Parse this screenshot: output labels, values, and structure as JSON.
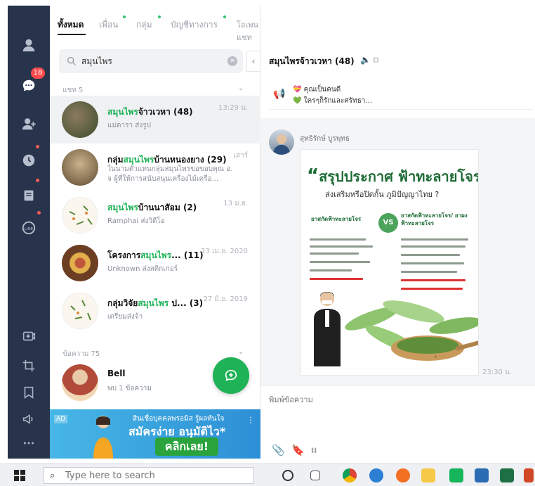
{
  "rail": {
    "badge": "18"
  },
  "tabs": [
    {
      "label": "ทั้งหมด"
    },
    {
      "label": "เพื่อน"
    },
    {
      "label": "กลุ่ม"
    },
    {
      "label": "บัญชีทางการ"
    },
    {
      "label": "โอเพนแชท"
    }
  ],
  "search": {
    "value": "สมุนไพร",
    "placeholder": ""
  },
  "sections": {
    "chats": "แชท 5",
    "messages": "ข้อความ 75"
  },
  "chats": [
    {
      "name_hl": "สมุนไพร",
      "name_rest": "จ้าวเวหา (48)",
      "name_pre": "",
      "sub": "แม่ดารา ส่งรูป",
      "time": "13:29 น."
    },
    {
      "name_pre": "กลุ่ม",
      "name_hl": "สมุนไพร",
      "name_rest": "บ้านหนองยาง (29)",
      "sub": "ในนามตัวแทนกลุ่มสมุนไพรขอขอบคุณ อ. จ ผู้ที่ให้การสนับสนุนเครื่องไม้เครื่อ...",
      "time": "เสาร์"
    },
    {
      "name_pre": "",
      "name_hl": "สมุนไพร",
      "name_rest": "บ้านนาสัอม (2)",
      "sub": "Ramphai ส่งวิดีโอ",
      "time": "13 ม.ย."
    },
    {
      "name_pre": "โครงการ",
      "name_hl": "สมุนไพร",
      "name_rest": "... (11)",
      "sub": "Unknown ส่งสติกเกอร์",
      "time": "23 เม.ย. 2020"
    },
    {
      "name_pre": "กลุ่มวิจัย",
      "name_hl": "สมุนไพร",
      "name_rest": " ป... (3)",
      "sub": "เตรียมส่งจ้า",
      "time": "27 มิ.ย. 2019"
    }
  ],
  "message_result": {
    "name": "Bell",
    "sub": "พบ 1 ข้อความ"
  },
  "ad": {
    "tag": "AD",
    "line1": "สินเชื่อบุคคลพรอมิส รู้ผลทันใจ",
    "line2": "สมัครง่าย อนุมัติไว*",
    "cta": "คลิกเลย!"
  },
  "chat": {
    "title": "สมุนไพรจ้าวเวหา (48)",
    "announce_l1": "คุณเป็นคนดี",
    "announce_l2": "ใครๆก็รักและศรัทธา...",
    "sender": "สุทธิรักษ์ บูรพุทธ",
    "time": "23:30 น.",
    "compose_placeholder": "พิมพ์ข้อความ"
  },
  "poster": {
    "title": "สรุปประกาศ ฟ้าทะลายโจร",
    "subtitle": "ส่งเสริมหรือปิดกั้น ภูมิปัญญาไทย ?",
    "left_head": "ยาสกัดฟ้าทะลายโจร",
    "vs": "VS",
    "right_head": "ยาสกัดฟ้าทะลายโจร/ ยาผงฟ้าทะลายโจร"
  },
  "taskbar": {
    "search_placeholder": "Type here to search"
  },
  "colors": {
    "accent": "#1fb257",
    "rail": "#27344b",
    "badge": "#ff4b4b"
  }
}
